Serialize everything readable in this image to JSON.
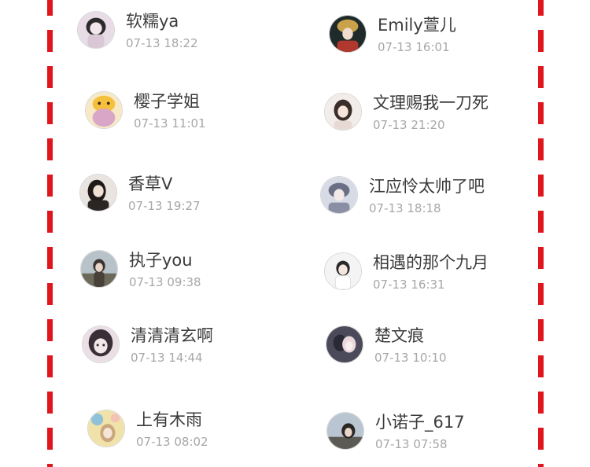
{
  "users": [
    {
      "name": "软糯ya",
      "time": "07-13 18:22",
      "avatar_icon": "avatar-dark-hair-girl",
      "colors": [
        "#e8dce7",
        "#2b2b2b"
      ]
    },
    {
      "name": "Emily萱儿",
      "time": "07-13 16:01",
      "avatar_icon": "avatar-costume-girl",
      "colors": [
        "#1f2a2a",
        "#b0382c"
      ]
    },
    {
      "name": "樱子学姐",
      "time": "07-13 11:01",
      "avatar_icon": "avatar-anime-cat",
      "colors": [
        "#f5c03c",
        "#d9a6c8"
      ]
    },
    {
      "name": "文理赐我一刀死",
      "time": "07-13 21:20",
      "avatar_icon": "avatar-girl-photo",
      "colors": [
        "#f3ede9",
        "#3a2e2a"
      ]
    },
    {
      "name": "香草V",
      "time": "07-13 19:27",
      "avatar_icon": "avatar-girl-dark",
      "colors": [
        "#e9e4df",
        "#1f1a18"
      ]
    },
    {
      "name": "江应怜太帅了吧",
      "time": "07-13 18:18",
      "avatar_icon": "avatar-anime-boy",
      "colors": [
        "#d7dbe6",
        "#6a6f85"
      ]
    },
    {
      "name": "执子you",
      "time": "07-13 09:38",
      "avatar_icon": "avatar-girl-outdoor",
      "colors": [
        "#b7c2c9",
        "#3b332f"
      ]
    },
    {
      "name": "相遇的那个九月",
      "time": "07-13 16:31",
      "avatar_icon": "avatar-girl-white",
      "colors": [
        "#f4f4f4",
        "#2a2a2a"
      ]
    },
    {
      "name": "清清清玄啊",
      "time": "07-13 14:44",
      "avatar_icon": "avatar-anime-girl",
      "colors": [
        "#eadfe4",
        "#3a2f36"
      ]
    },
    {
      "name": "楚文痕",
      "time": "07-13 10:10",
      "avatar_icon": "avatar-anime-couple",
      "colors": [
        "#4a4a5a",
        "#e9d7dc"
      ]
    },
    {
      "name": "上有木雨",
      "time": "07-13 08:02",
      "avatar_icon": "avatar-flower-girl",
      "colors": [
        "#f0e2a8",
        "#8fc2d9"
      ]
    },
    {
      "name": "小诺子_617",
      "time": "07-13 07:58",
      "avatar_icon": "avatar-girl-sky",
      "colors": [
        "#b9c6d1",
        "#2c2623"
      ]
    }
  ],
  "border_color": "#e0161e"
}
